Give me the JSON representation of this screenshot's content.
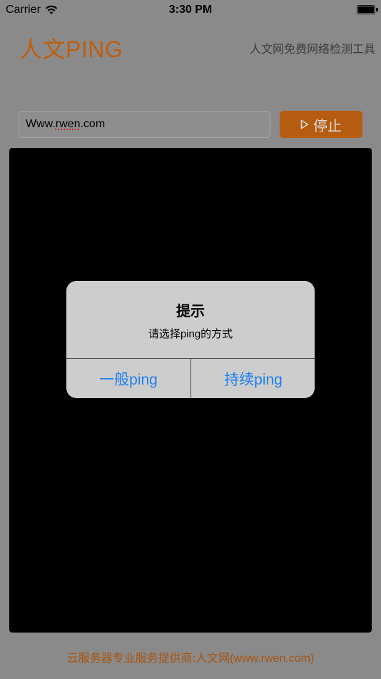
{
  "status_bar": {
    "carrier": "Carrier",
    "time": "3:30 PM",
    "wifi_icon": "wifi-icon",
    "battery_icon": "battery-full-icon"
  },
  "header": {
    "title": "人文PING",
    "subtitle": "人文网免费网络检测工具",
    "accent_color": "#bf5e0d"
  },
  "host_input": {
    "value": "Www.rwen.com"
  },
  "stop_button": {
    "icon": "play-icon",
    "label": "停止",
    "color": "#b65c10"
  },
  "console": {
    "background": "#000000"
  },
  "alert": {
    "title": "提示",
    "message": "请选择ping的方式",
    "buttons": [
      {
        "label": "一般ping"
      },
      {
        "label": "持续ping"
      }
    ],
    "button_color": "#1e7ff0"
  },
  "footer": {
    "text": "云服务器专业服务提供商:人文网(www.rwen.com)"
  }
}
